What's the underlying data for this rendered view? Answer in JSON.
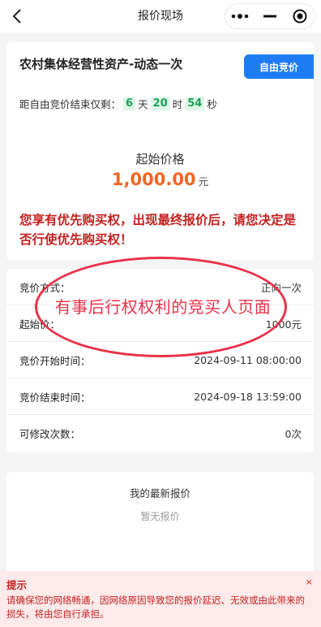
{
  "header": {
    "title": "报价现场",
    "back_icon": "chevron-left-icon",
    "more_icon": "more-dots-icon",
    "minimize_icon": "minimize-icon",
    "close_icon": "target-close-icon"
  },
  "auction": {
    "asset_title": "农村集体经营性资产-动态一次",
    "mode_tag": "自由竞价",
    "countdown": {
      "prefix": "距自由竞价结束仅剩：",
      "days": "6",
      "days_unit": "天",
      "hours": "20",
      "hours_unit": "时",
      "minutes": "54",
      "minutes_unit": "秒"
    },
    "start_price_label": "起始价格",
    "start_price": "1,000.00",
    "start_price_unit": "元",
    "priority_note": "您享有优先购买权，出现最终报价后，请您决定是否行使优先购买权！"
  },
  "details": [
    {
      "label": "竞价方式：",
      "value": "正向一次"
    },
    {
      "label": "起始价：",
      "value": "1000元"
    },
    {
      "label": "竞价开始时间：",
      "value": "2024-09-11 08:00:00"
    },
    {
      "label": "竞价结束时间：",
      "value": "2024-09-18 13:59:00"
    },
    {
      "label": "可修改次数：",
      "value": "0次"
    }
  ],
  "annotation": {
    "text": "有事后行权权利的竞买人页面",
    "color": "#e8324a"
  },
  "latest_bid": {
    "title": "我的最新报价",
    "empty_text": "暂无报价"
  },
  "tip": {
    "title": "提示",
    "text": "请确保您的网络畅通，因网络原因导致您的报价延迟、无效或由此带来的损失，将由您自行承担。",
    "close": "×"
  },
  "colors": {
    "accent_blue": "#1e7cf2",
    "price_orange": "#f26522",
    "warning_red": "#c41f1f",
    "countdown_green": "#1aa35a"
  }
}
